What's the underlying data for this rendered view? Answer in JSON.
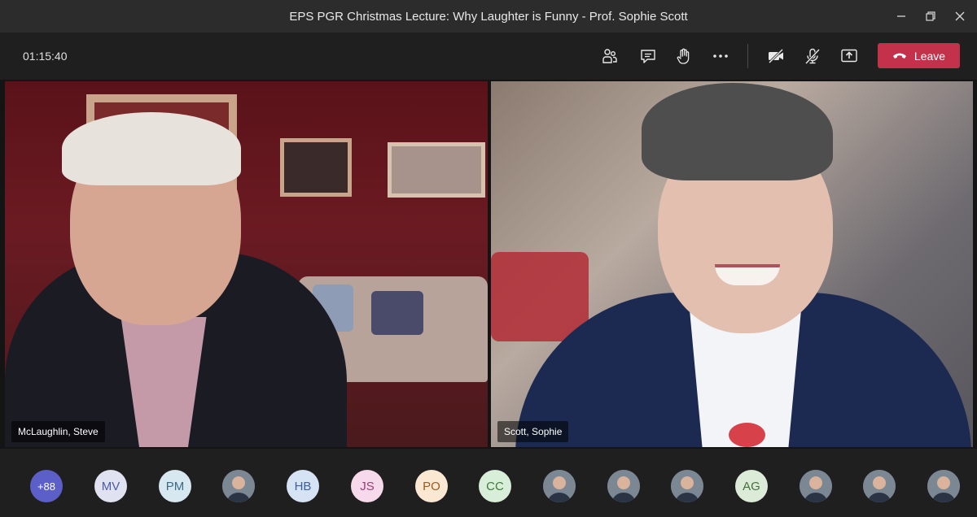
{
  "window": {
    "title": "EPS PGR Christmas Lecture: Why Laughter is Funny - Prof. Sophie Scott"
  },
  "toolbar": {
    "timer": "01:15:40",
    "leave_label": "Leave"
  },
  "icons": {
    "participants": "people-icon",
    "chat": "chat-icon",
    "raise_hand": "hand-icon",
    "more": "more-icon",
    "camera": "camera-off-icon",
    "mic": "mic-off-icon",
    "share": "share-icon",
    "leave": "phone-hangup-icon"
  },
  "colors": {
    "leave_button": "#c4314b",
    "overflow_badge": "#5b5fc7"
  },
  "videos": [
    {
      "name": "McLaughlin, Steve"
    },
    {
      "name": "Scott, Sophie"
    }
  ],
  "roster": {
    "overflow": "+88",
    "participants": [
      {
        "initials": "MV",
        "bg": "#e0e2f2",
        "fg": "#4f5b9f"
      },
      {
        "initials": "PM",
        "bg": "#d8e8f0",
        "fg": "#3d6a87"
      },
      {
        "initials": "",
        "photo": true
      },
      {
        "initials": "HB",
        "bg": "#d6e3f5",
        "fg": "#3e5f9c"
      },
      {
        "initials": "JS",
        "bg": "#f6d9ea",
        "fg": "#9a3d72"
      },
      {
        "initials": "PO",
        "bg": "#fbe8d3",
        "fg": "#9b5b1f"
      },
      {
        "initials": "CC",
        "bg": "#d9eed9",
        "fg": "#3f7a3f"
      },
      {
        "initials": "",
        "photo": true
      },
      {
        "initials": "",
        "photo": true
      },
      {
        "initials": "",
        "photo": true
      },
      {
        "initials": "AG",
        "bg": "#dcebd8",
        "fg": "#44703a"
      },
      {
        "initials": "",
        "photo": true
      },
      {
        "initials": "",
        "photo": true
      },
      {
        "initials": "",
        "photo": true
      }
    ]
  }
}
